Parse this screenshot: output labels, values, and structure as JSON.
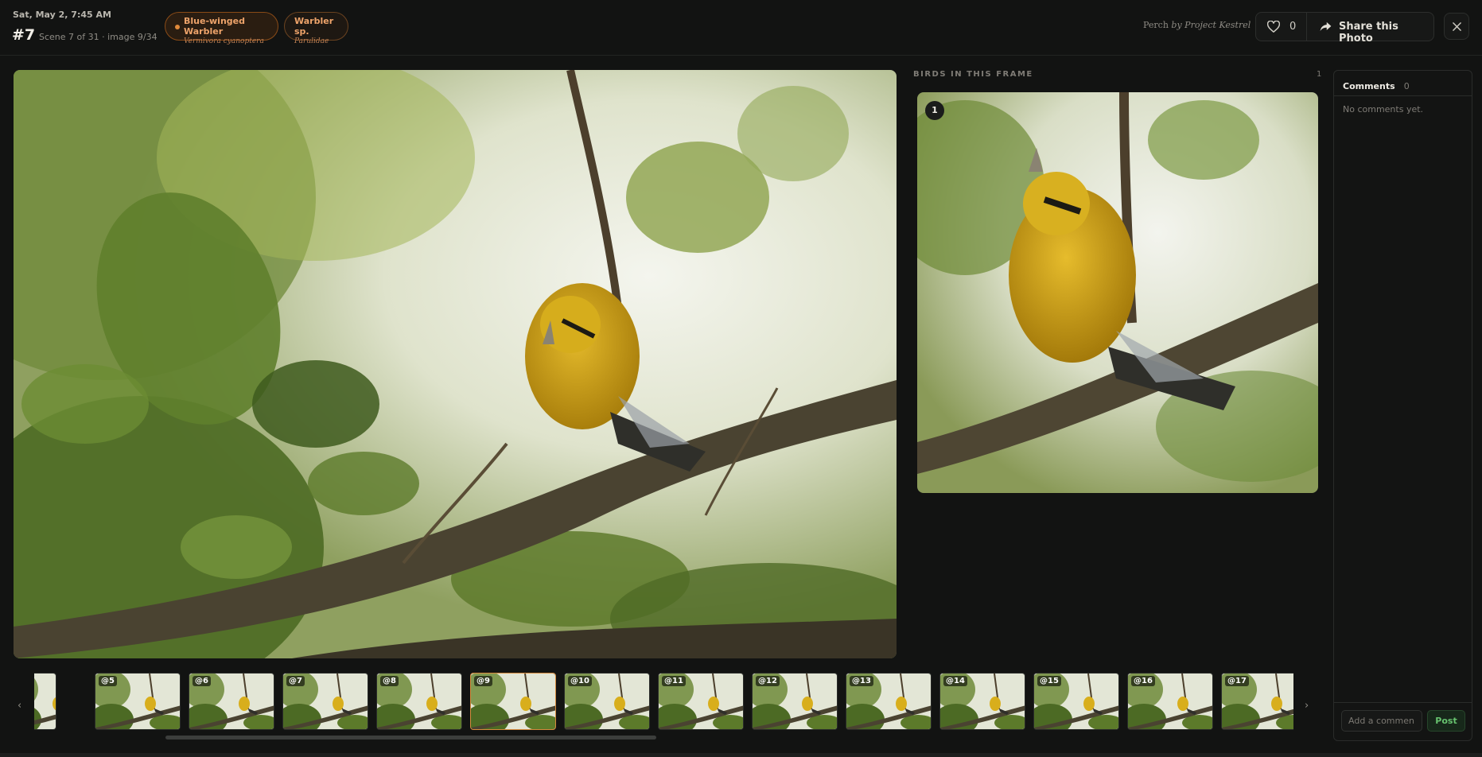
{
  "header": {
    "date": "Sat, May 2, 7:45 AM",
    "frame_number": "#7",
    "frame_meta": "Scene 7 of 31 · image 9/34",
    "tags": [
      {
        "name": "Blue-winged Warbler",
        "scientific": "Vermivora cyanoptera"
      },
      {
        "name": "Warbler sp.",
        "scientific": "Parulidae"
      }
    ],
    "brand_prefix": "Perch",
    "brand_suffix": "by Project Kestrel",
    "like_count": "0",
    "share_label": "Share this Photo"
  },
  "birds_panel": {
    "title": "BIRDS IN THIS FRAME",
    "count": "1",
    "crops": [
      {
        "badge": "1"
      }
    ]
  },
  "comments": {
    "title": "Comments",
    "count": "0",
    "empty_text": "No comments yet.",
    "input_placeholder": "Add a commen",
    "post_label": "Post"
  },
  "filmstrip": {
    "labels": [
      "",
      "@5",
      "@6",
      "@7",
      "@8",
      "@9",
      "@10",
      "@11",
      "@12",
      "@13",
      "@14",
      "@15",
      "@16",
      "@17"
    ],
    "active_label": "@9",
    "prev_symbol": "‹",
    "next_symbol": "›"
  },
  "colors": {
    "background": "#121312",
    "accent_orange": "#e0893a",
    "post_green": "#67c36f"
  }
}
